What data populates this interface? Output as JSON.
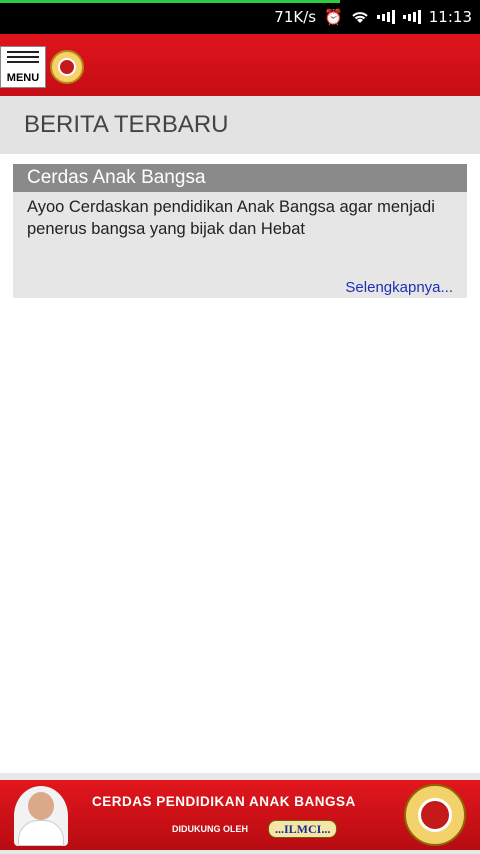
{
  "status_bar": {
    "net_speed": "71K/s",
    "time": "11:13",
    "icons": [
      "alarm-icon",
      "wifi-icon",
      "signal-icon",
      "signal-icon"
    ]
  },
  "app_bar": {
    "menu_label": "MENU",
    "accent_color": "#d8121a"
  },
  "section": {
    "title": "BERITA TERBARU"
  },
  "news": [
    {
      "title": "Cerdas Anak Bangsa",
      "description": "Ayoo Cerdaskan pendidikan Anak Bangsa agar menjadi penerus bangsa yang bijak dan Hebat",
      "more_label": "Selengkapnya..."
    }
  ],
  "banner": {
    "headline": "CERDAS PENDIDIKAN ANAK BANGSA",
    "support_text": "DIDUKUNG OLEH",
    "sponsor": "...ILMCI..."
  }
}
